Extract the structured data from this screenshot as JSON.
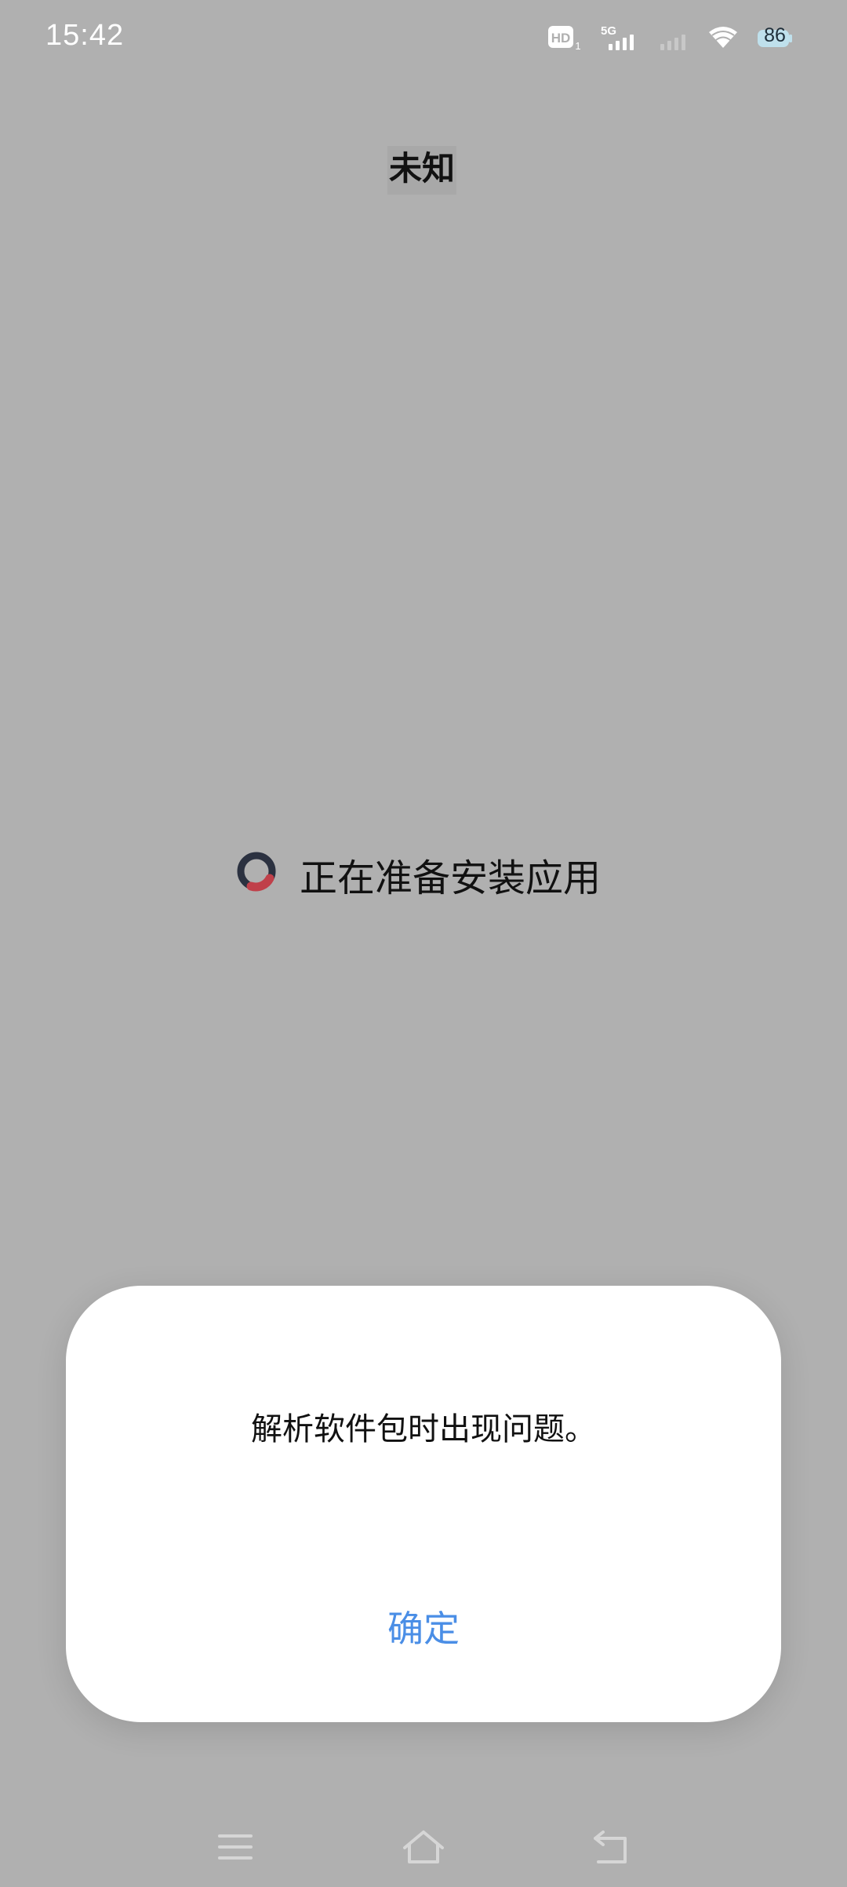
{
  "status_bar": {
    "time": "15:42",
    "hd_label": "HD",
    "hd_sub": "1",
    "network_label": "5G",
    "battery_level": "86",
    "icons": [
      "hd-voice-icon",
      "signal-5g-icon",
      "signal-secondary-icon",
      "wifi-icon",
      "battery-icon"
    ]
  },
  "header": {
    "title": "未知"
  },
  "main": {
    "status_text": "正在准备安装应用",
    "spinner_icon": "loading-spinner-icon"
  },
  "dialog": {
    "message": "解析软件包时出现问题。",
    "ok_label": "确定",
    "accent_color": "#4a8ee6"
  },
  "nav_bar": {
    "icons": [
      "menu-icon",
      "home-icon",
      "back-icon"
    ]
  }
}
